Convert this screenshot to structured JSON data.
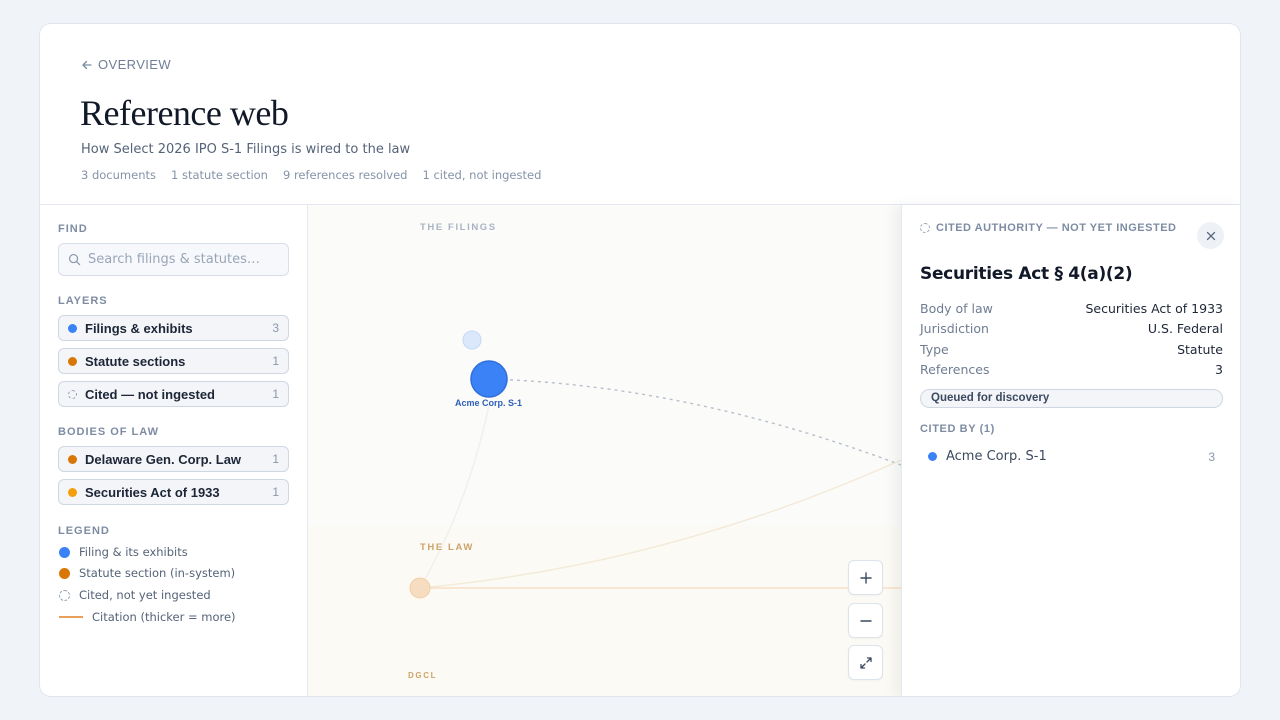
{
  "header": {
    "back_label": "OVERVIEW",
    "title": "Reference web",
    "subtitle": "How Select 2026 IPO S-1 Filings is wired to the law",
    "stats": [
      "3 documents",
      "1 statute section",
      "9 references resolved",
      "1 cited, not ingested"
    ]
  },
  "sidebar": {
    "find_label": "FIND",
    "search_placeholder": "Search filings & statutes…",
    "layers_label": "LAYERS",
    "layers": [
      {
        "label": "Filings & exhibits",
        "count": "3",
        "color": "#3b82f6"
      },
      {
        "label": "Statute sections",
        "count": "1",
        "color": "#d97706"
      },
      {
        "label": "Cited — not ingested",
        "count": "1",
        "color": "dashed"
      }
    ],
    "bodies_label": "BODIES OF LAW",
    "bodies": [
      {
        "label": "Delaware Gen. Corp. Law",
        "count": "1",
        "color": "#d97706"
      },
      {
        "label": "Securities Act of 1933",
        "count": "1",
        "color": "#f59e0b"
      }
    ],
    "legend_label": "LEGEND",
    "legend": [
      {
        "label": "Filing & its exhibits",
        "kind": "blue-dot"
      },
      {
        "label": "Statute section (in-system)",
        "kind": "orange-dot"
      },
      {
        "label": "Cited, not yet ingested",
        "kind": "dashed-dot"
      },
      {
        "label": "Citation (thicker = more)",
        "kind": "line"
      }
    ]
  },
  "graph": {
    "filings_label": "THE FILINGS",
    "law_label": "THE LAW",
    "dgcl_label": "DGCL",
    "node_acme_label": "Acme Corp. S-1",
    "zoom_in_icon": "plus-icon",
    "zoom_out_icon": "minus-icon",
    "fit_icon": "expand-icon"
  },
  "detail": {
    "kicker": "CITED AUTHORITY — NOT YET INGESTED",
    "title": "Securities Act § 4(a)(2)",
    "fields": [
      {
        "key": "Body of law",
        "value": "Securities Act of 1933"
      },
      {
        "key": "Jurisdiction",
        "value": "U.S. Federal"
      },
      {
        "key": "Type",
        "value": "Statute"
      },
      {
        "key": "References",
        "value": "3"
      }
    ],
    "status_badge": "Queued for discovery",
    "cited_by_label": "CITED BY (1)",
    "cited_by": [
      {
        "name": "Acme Corp. S-1",
        "count": "3"
      }
    ]
  },
  "colors": {
    "filing_blue": "#3b82f6",
    "statute_orange": "#d97706",
    "securities_amber": "#f59e0b",
    "citation_line": "#e9a05b"
  }
}
